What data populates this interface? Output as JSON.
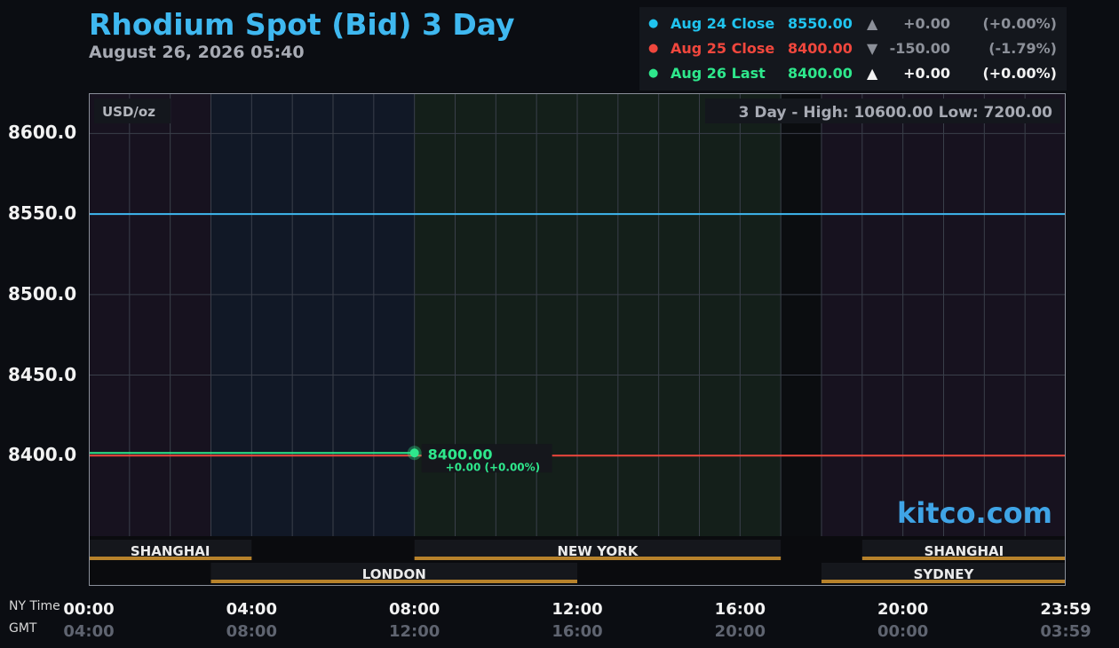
{
  "header": {
    "title": "Rhodium Spot (Bid) 3 Day",
    "datetime": "August 26, 2026 05:40"
  },
  "legend": [
    {
      "label": "Aug 24 Close",
      "value": "8550.00",
      "arrow": "▲",
      "change": "+0.00",
      "pct": "(+0.00%)",
      "color": "#20c4ef",
      "dim": true
    },
    {
      "label": "Aug 25 Close",
      "value": "8400.00",
      "arrow": "▼",
      "change": "-150.00",
      "pct": "(-1.79%)",
      "color": "#f0473d",
      "dim": true
    },
    {
      "label": "Aug 26 Last",
      "value": "8400.00",
      "arrow": "▲",
      "change": "+0.00",
      "pct": "(+0.00%)",
      "color": "#2ee88c",
      "dim": false
    }
  ],
  "chart_data": {
    "type": "line",
    "unit_label": "USD/oz",
    "range_text": "3 Day - High: 10600.00  Low: 7200.00",
    "ylim": [
      8350,
      8625
    ],
    "yticks": [
      "8600.0",
      "8550.0",
      "8500.0",
      "8450.0",
      "8400.0"
    ],
    "ytick_values": [
      8600,
      8550,
      8500,
      8450,
      8400
    ],
    "xlim_hours": [
      0,
      24
    ],
    "series": [
      {
        "label": "Aug 24 Close",
        "color": "#3fb8f0",
        "points": [
          [
            0,
            8550
          ],
          [
            24,
            8550
          ]
        ]
      },
      {
        "label": "Aug 25 Close",
        "color": "#f0473d",
        "points": [
          [
            0,
            8400
          ],
          [
            24,
            8400
          ]
        ]
      },
      {
        "label": "Aug 26 Last",
        "color": "#2ee88c",
        "points": [
          [
            0,
            8400
          ],
          [
            8,
            8400
          ]
        ]
      }
    ],
    "last_point": {
      "x": 8,
      "y": 8400,
      "label": "8400.00",
      "change": "+0.00 (+0.00%)"
    },
    "sessions": [
      {
        "name": "SHANGHAI",
        "row": 0,
        "start": 0,
        "end": 4,
        "label_at": 2
      },
      {
        "name": "NEW YORK",
        "row": 0,
        "start": 8,
        "end": 17,
        "label_at": 12.5
      },
      {
        "name": "SHANGHAI",
        "row": 0,
        "start": 19,
        "end": 24,
        "label_at": 21.5
      },
      {
        "name": "LONDON",
        "row": 1,
        "start": 3,
        "end": 12,
        "label_at": 7.5
      },
      {
        "name": "SYDNEY",
        "row": 1,
        "start": 18,
        "end": 24,
        "label_at": 21
      }
    ],
    "x_axis": {
      "ny_label": "NY Time",
      "gmt_label": "GMT",
      "ticks": [
        {
          "h": 0,
          "ny": "00:00",
          "gmt": "04:00"
        },
        {
          "h": 4,
          "ny": "04:00",
          "gmt": "08:00"
        },
        {
          "h": 8,
          "ny": "08:00",
          "gmt": "12:00"
        },
        {
          "h": 12,
          "ny": "12:00",
          "gmt": "16:00"
        },
        {
          "h": 16,
          "ny": "16:00",
          "gmt": "20:00"
        },
        {
          "h": 20,
          "ny": "20:00",
          "gmt": "00:00"
        },
        {
          "h": 24,
          "ny": "23:59",
          "gmt": "03:59"
        }
      ]
    }
  },
  "watermark": "kitco.com",
  "colors": {
    "accent": "#3fb8f0",
    "session_bar": "#b7822b",
    "up": "#2ee88c",
    "down": "#f0473d"
  }
}
